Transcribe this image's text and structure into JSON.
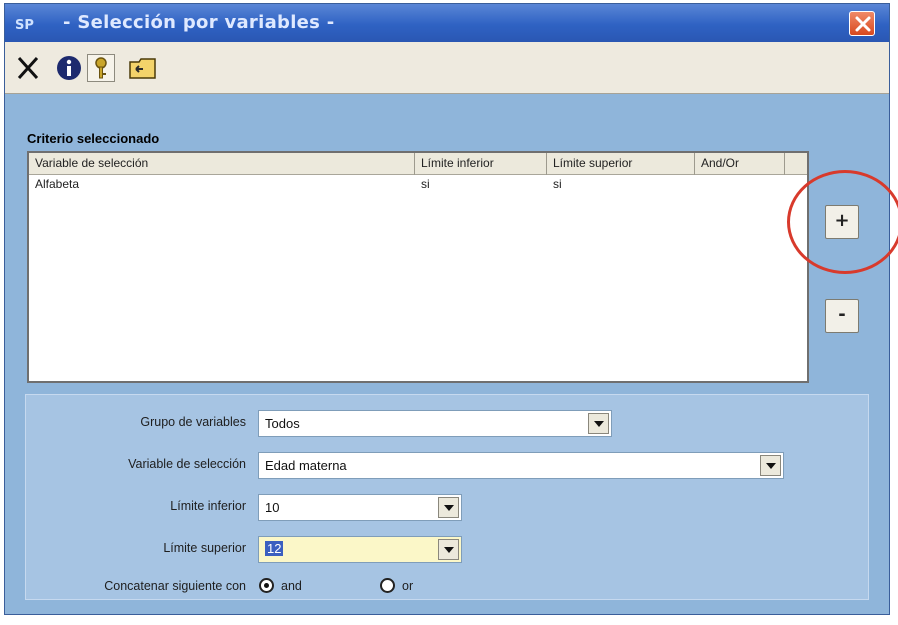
{
  "window": {
    "title": "- Selección por variables -",
    "app_icon": "SP"
  },
  "toolbar": {
    "buttons": [
      "close-icon",
      "info-icon",
      "key-icon",
      "folder-icon"
    ]
  },
  "criteria": {
    "section_title": "Criterio seleccionado",
    "columns": [
      "Variable de selección",
      "Límite inferior",
      "Límite superior",
      "And/Or"
    ],
    "rows": [
      {
        "variable": "Alfabeta",
        "lower": "si",
        "upper": "si",
        "andor": ""
      }
    ]
  },
  "side_buttons": {
    "add": "+",
    "remove": "-"
  },
  "form": {
    "group_label": "Grupo de variables",
    "group_value": "Todos",
    "variable_label": "Variable de selección",
    "variable_value": "Edad materna",
    "lower_label": "Límite inferior",
    "lower_value": "10",
    "upper_label": "Límite superior",
    "upper_value": "12",
    "concat_label": "Concatenar siguiente con",
    "option_and": "and",
    "option_or": "or",
    "selected_option": "and"
  },
  "colors": {
    "title_bar": "#2f62c3",
    "window_bg": "#8fb5da",
    "highlight_circle": "#d83a2c",
    "upper_field_bg": "#fbf7c8"
  }
}
